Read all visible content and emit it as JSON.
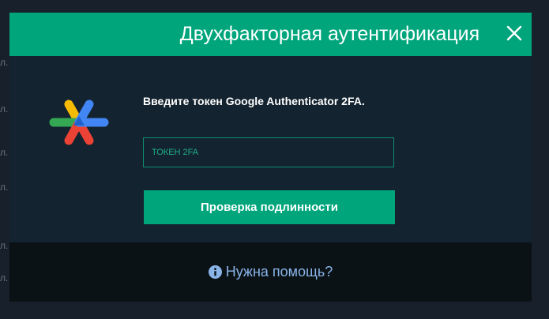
{
  "background": {
    "edge_marks": [
      "л.",
      "л.",
      "л.",
      "л.",
      "л.",
      "л."
    ]
  },
  "modal": {
    "title": "Двухфакторная аутентификация",
    "close_icon": "close-icon",
    "logo_icon": "google-authenticator-icon",
    "prompt": "Введите токен Google Authenticator 2FA.",
    "token_input": {
      "placeholder": "ТОКЕН 2FA",
      "value": ""
    },
    "verify_button_label": "Проверка подлинности",
    "help": {
      "icon": "info-icon",
      "label": "Нужна помощь?"
    }
  },
  "colors": {
    "accent": "#00a57c",
    "modal_bg": "#13232f",
    "footer_bg": "#0a1216",
    "link": "#8ab4e8",
    "input_border": "#0f8f70"
  }
}
